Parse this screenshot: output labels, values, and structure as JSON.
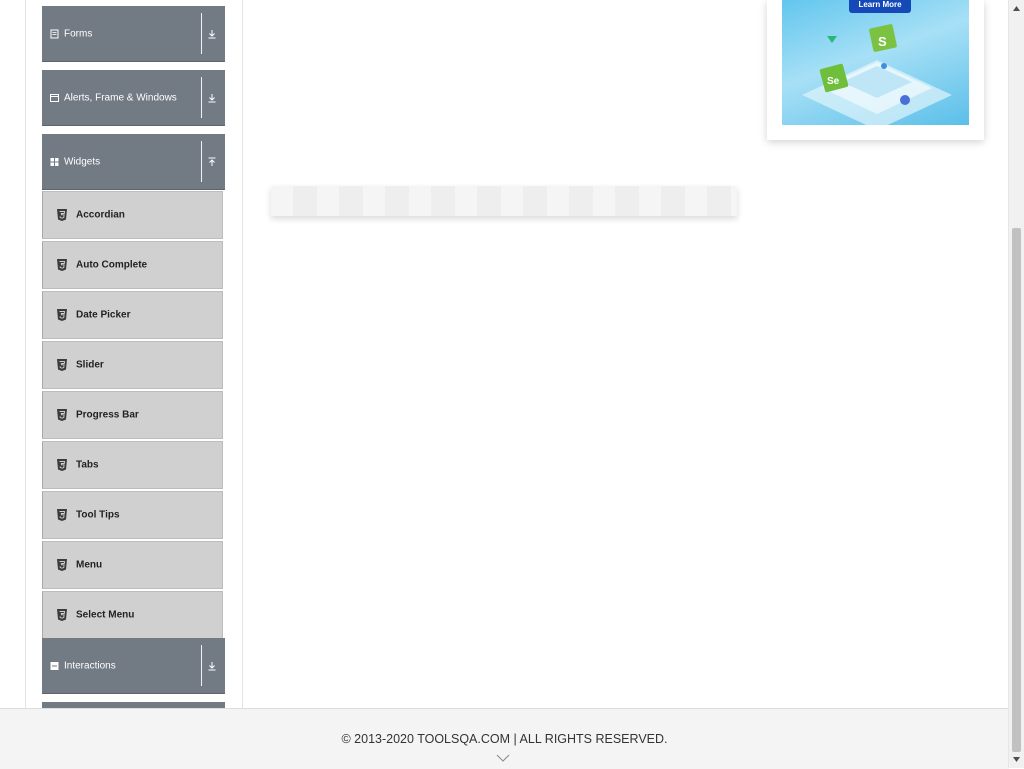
{
  "sidebar": {
    "groups": {
      "forms": {
        "label": "Forms",
        "icon": "document-icon",
        "arrow": "download-arrow-icon"
      },
      "alerts": {
        "label": "Alerts, Frame & Windows",
        "icon": "window-icon",
        "arrow": "download-arrow-icon"
      },
      "widgets": {
        "label": "Widgets",
        "icon": "grid-icon",
        "arrow": "upload-arrow-icon"
      },
      "interactions": {
        "label": "Interactions",
        "icon": "square-icon",
        "arrow": "download-arrow-icon"
      }
    },
    "widget_items": [
      {
        "label": "Accordian"
      },
      {
        "label": "Auto Complete"
      },
      {
        "label": "Date Picker"
      },
      {
        "label": "Slider"
      },
      {
        "label": "Progress Bar"
      },
      {
        "label": "Tabs"
      },
      {
        "label": "Tool Tips"
      },
      {
        "label": "Menu"
      },
      {
        "label": "Select Menu"
      }
    ]
  },
  "ad": {
    "button_label": "Learn More"
  },
  "footer": {
    "copyright": "© 2013-2020 TOOLSQA.COM | ALL RIGHTS RESERVED."
  },
  "colors": {
    "group_header_bg": "#727a84",
    "sub_item_bg": "#d0d0d0",
    "ad_button": "#1549b8"
  }
}
